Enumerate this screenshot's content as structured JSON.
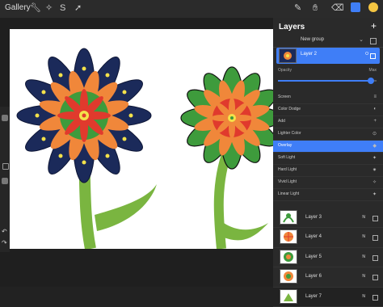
{
  "topbar": {
    "gallery_label": "Gallery",
    "left_tools": [
      "wrench-icon",
      "magic-wand-icon",
      "selection-icon",
      "transform-icon"
    ],
    "right_tools": [
      "brush-icon",
      "smudge-icon",
      "eraser-icon",
      "layers-icon",
      "color-icon"
    ]
  },
  "left_sidebar": {
    "undo_label": "↶",
    "redo_label": "↷"
  },
  "layers_panel": {
    "title": "Layers",
    "add_label": "+",
    "group": {
      "label": "New group"
    },
    "selected_layer": {
      "label": "Layer 2",
      "blend_short": "O"
    },
    "opacity": {
      "label": "Opacity",
      "max_label": "Max",
      "value": 0.94
    },
    "blend_modes": [
      {
        "label": "Screen",
        "icon": "≡"
      },
      {
        "label": "Color Dodge",
        "icon": "◐"
      },
      {
        "label": "Add",
        "icon": "+"
      },
      {
        "label": "Lighter Color",
        "icon": "⊙"
      },
      {
        "label": "Overlay",
        "icon": "◆",
        "selected": true
      },
      {
        "label": "Soft Light",
        "icon": "✦"
      },
      {
        "label": "Hard Light",
        "icon": "✷"
      },
      {
        "label": "Vivid Light",
        "icon": "✧"
      },
      {
        "label": "Linear Light",
        "icon": "✦"
      }
    ],
    "layers": [
      {
        "label": "Layer 3",
        "mode": "N"
      },
      {
        "label": "Layer 4",
        "mode": "N"
      },
      {
        "label": "Layer 5",
        "mode": "N"
      },
      {
        "label": "Layer 6",
        "mode": "N"
      },
      {
        "label": "Layer 7",
        "mode": "N"
      }
    ]
  },
  "colors": {
    "accent": "#3f7ef7",
    "navy": "#1b2a5a",
    "orange": "#f0873a",
    "green": "#3e9b3c",
    "red": "#e03a2d",
    "yellow": "#f3e24a",
    "stem": "#7ab540"
  }
}
